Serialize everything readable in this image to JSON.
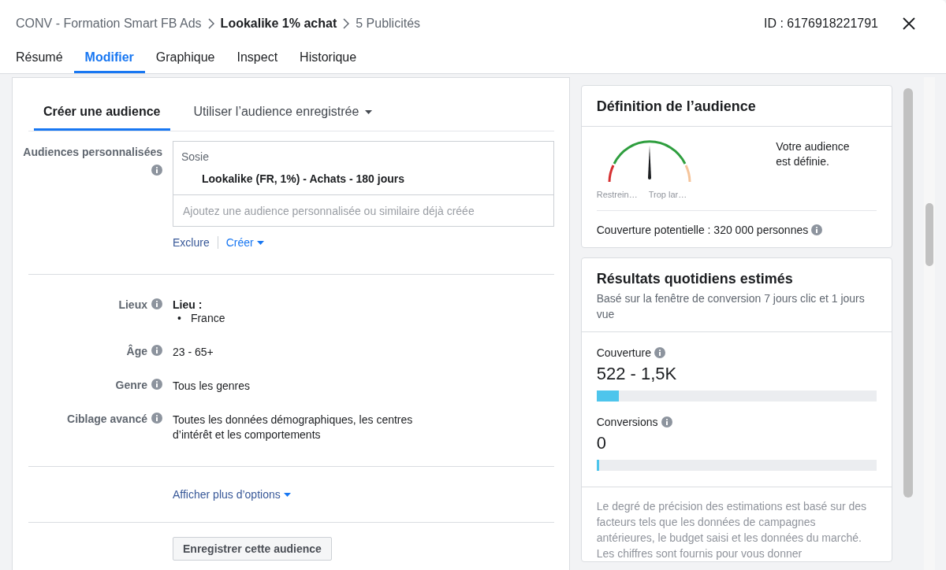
{
  "header": {
    "breadcrumb": [
      {
        "text": "CONV - Formation Smart FB Ads",
        "current": false
      },
      {
        "text": "Lookalike 1% achat",
        "current": true
      },
      {
        "text": "5 Publicités",
        "current": false
      }
    ],
    "id_label": "ID : 6176918221791",
    "tabs": [
      {
        "label": "Résumé",
        "selected": false
      },
      {
        "label": "Modifier",
        "selected": true
      },
      {
        "label": "Graphique",
        "selected": false
      },
      {
        "label": "Inspect",
        "selected": false
      },
      {
        "label": "Historique",
        "selected": false
      }
    ]
  },
  "audience": {
    "tabs": [
      {
        "label": "Créer une audience",
        "selected": true,
        "has_menu": false
      },
      {
        "label": "Utiliser l’audience enregistrée",
        "selected": false,
        "has_menu": true
      }
    ],
    "custom": {
      "label": "Audiences personnalisées",
      "group_label": "Sosie",
      "item": "Lookalike (FR, 1%) - Achats - 180 jours",
      "placeholder": "Ajoutez une audience personnalisée ou similaire déjà créée",
      "links": [
        {
          "label": "Exclure",
          "has_menu": false
        },
        {
          "label": "Créer",
          "has_menu": true
        }
      ]
    },
    "fields": [
      {
        "label": "Lieux",
        "kind": "list",
        "heading": "Lieu :",
        "items": [
          {
            "bullet": "•",
            "text": "France"
          }
        ]
      },
      {
        "label": "Âge",
        "kind": "text",
        "value": "23 - 65+"
      },
      {
        "label": "Genre",
        "kind": "text",
        "value": "Tous les genres"
      },
      {
        "label": "Ciblage avancé",
        "kind": "text",
        "value": "Toutes les données démographiques, les centres d’intérêt et les comportements"
      }
    ],
    "more_options": "Afficher plus d’options",
    "save_button": "Enregistrer cette audience"
  },
  "definition": {
    "title": "Définition de l’audience",
    "gauge_labels": [
      "Restrein…",
      "Trop lar…"
    ],
    "status": "Votre audience est définie.",
    "potential_reach": "Couverture potentielle : 320 000 personnes"
  },
  "results": {
    "title": "Résultats quotidiens estimés",
    "subtitle": "Basé sur la fenêtre de conversion 7 jours clic et 1 jours vue",
    "metrics": [
      {
        "label": "Couverture",
        "value": "522 - 1,5K",
        "level": 0.08
      },
      {
        "label": "Conversions",
        "value": "0",
        "level": 0.01
      }
    ],
    "disclaimer": "Le degré de précision des estimations est basé sur des facteurs tels que les données de campagnes antérieures, le budget saisi et les données du marché. Les chiffres sont fournis pour vous donner"
  }
}
